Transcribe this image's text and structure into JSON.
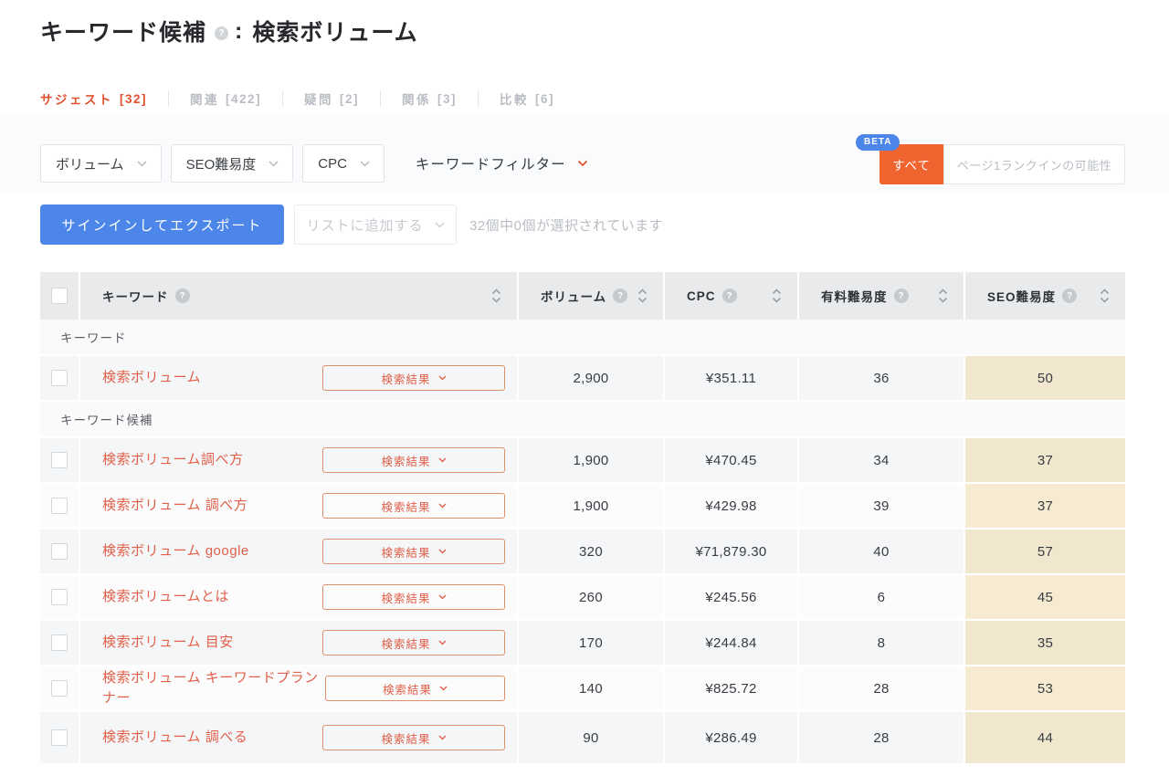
{
  "header": {
    "title": "キーワード候補",
    "separator": ":",
    "keyword": "検索ボリューム"
  },
  "icons": {
    "help": "?"
  },
  "tabs": [
    {
      "label": "サジェスト",
      "count": "[32]",
      "active": true
    },
    {
      "label": "関連",
      "count": "[422]",
      "active": false
    },
    {
      "label": "疑問",
      "count": "[2]",
      "active": false
    },
    {
      "label": "関係",
      "count": "[3]",
      "active": false
    },
    {
      "label": "比較",
      "count": "[6]",
      "active": false
    }
  ],
  "filters": {
    "dropdowns": [
      {
        "label": "ボリューム"
      },
      {
        "label": "SEO難易度"
      },
      {
        "label": "CPC"
      }
    ],
    "keyword_filter_label": "キーワードフィルター",
    "beta_badge": "BETA",
    "toggle": {
      "active_label": "すべて",
      "inactive_label": "ページ1ランクインの可能性"
    }
  },
  "actions": {
    "export_button": "サインインしてエクスポート",
    "add_to_list_button": "リストに追加する",
    "selection_info": "32個中0個が選択されています"
  },
  "table": {
    "result_button": "検索結果",
    "columns": [
      {
        "key": "keyword",
        "label": "キーワード"
      },
      {
        "key": "volume",
        "label": "ボリューム"
      },
      {
        "key": "cpc",
        "label": "CPC"
      },
      {
        "key": "paid",
        "label": "有料難易度"
      },
      {
        "key": "seo",
        "label": "SEO難易度"
      }
    ],
    "sections": [
      {
        "label": "キーワード",
        "rows": [
          {
            "keyword": "検索ボリューム",
            "volume": "2,900",
            "cpc": "¥351.11",
            "paid": "36",
            "seo": "50"
          }
        ]
      },
      {
        "label": "キーワード候補",
        "rows": [
          {
            "keyword": "検索ボリューム調べ方",
            "volume": "1,900",
            "cpc": "¥470.45",
            "paid": "34",
            "seo": "37"
          },
          {
            "keyword": "検索ボリューム 調べ方",
            "volume": "1,900",
            "cpc": "¥429.98",
            "paid": "39",
            "seo": "37"
          },
          {
            "keyword": "検索ボリューム google",
            "volume": "320",
            "cpc": "¥71,879.30",
            "paid": "40",
            "seo": "57"
          },
          {
            "keyword": "検索ボリュームとは",
            "volume": "260",
            "cpc": "¥245.56",
            "paid": "6",
            "seo": "45"
          },
          {
            "keyword": "検索ボリューム 目安",
            "volume": "170",
            "cpc": "¥244.84",
            "paid": "8",
            "seo": "35"
          },
          {
            "keyword": "検索ボリューム キーワードプランナー",
            "volume": "140",
            "cpc": "¥825.72",
            "paid": "28",
            "seo": "53"
          },
          {
            "keyword": "検索ボリューム 調べる",
            "volume": "90",
            "cpc": "¥286.49",
            "paid": "28",
            "seo": "44"
          }
        ]
      }
    ]
  },
  "colors": {
    "accent_orange": "#f0642f",
    "tab_active_orange": "#e2512d",
    "link_orange": "#e0604a",
    "primary_blue": "#4c86e8",
    "beta_blue": "#4c86e8",
    "header_gray": "#e9eaeb",
    "seo_cell_beige": "#f5ebd5",
    "muted_gray": "#b9bdc3"
  }
}
